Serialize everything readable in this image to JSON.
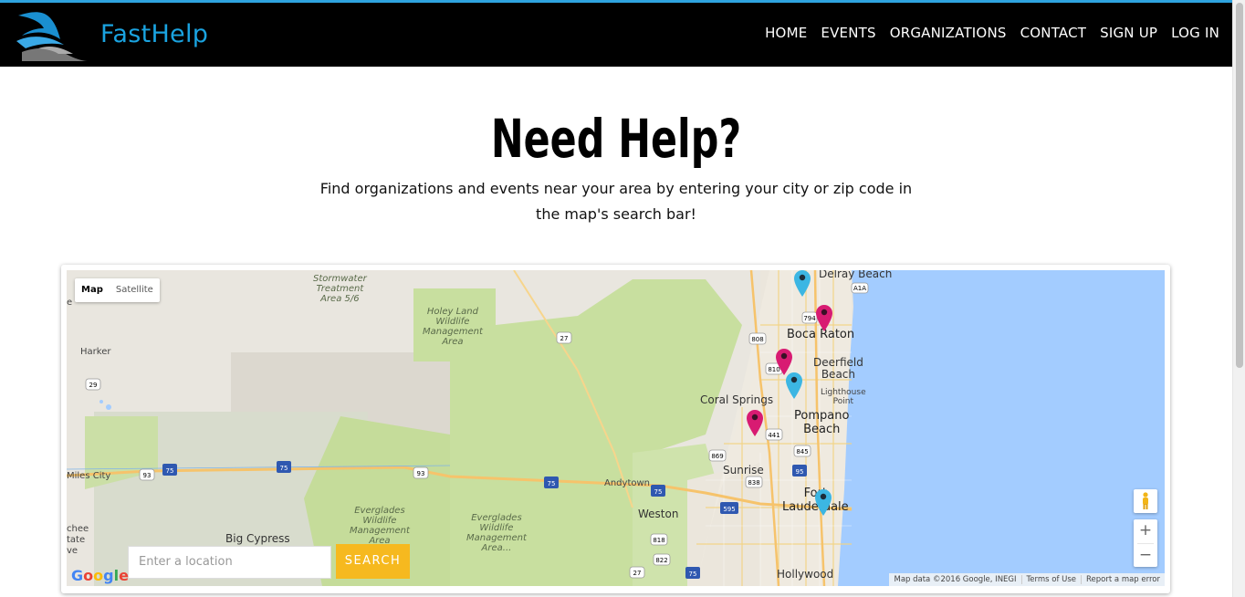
{
  "brand": {
    "name": "FastHelp"
  },
  "nav": {
    "items": [
      "HOME",
      "EVENTS",
      "ORGANIZATIONS",
      "CONTACT",
      "SIGN UP",
      "LOG IN"
    ]
  },
  "hero": {
    "title": "Need Help?",
    "subtitle": "Find organizations and events near your area by entering your city or zip code in the map's search bar!"
  },
  "map": {
    "type_buttons": {
      "map": "Map",
      "satellite": "Satellite"
    },
    "search": {
      "placeholder": "Enter a location",
      "button": "SEARCH"
    },
    "labels": {
      "delray": "Delray Beach",
      "boca": "Boca Raton",
      "deerfield": "Deerfield\nBeach",
      "lighthouse": "Lighthouse\nPoint",
      "coral": "Coral Springs",
      "pompano": "Pompano\nBeach",
      "sunrise": "Sunrise",
      "ftl": "Fort\nLauderdale",
      "weston": "Weston",
      "hollywood": "Hollywood",
      "andytown": "Andytown",
      "harker": "Harker",
      "miles": "Miles City",
      "bigcypress": "Big Cypress",
      "stormwater": "Stormwater\nTreatment\nArea 5/6",
      "holey": "Holey Land\nWildlife\nManagement\nArea",
      "everglades1": "Everglades\nWildlife\nManagement\nArea",
      "everglades2": "Everglades\nWildlife\nManagement\nArea...",
      "leftedge": "chee\ntate\nve",
      "e": "e"
    },
    "google": "Google",
    "attribution": [
      "Map data ©2016 Google, INEGI",
      "Terms of Use",
      "Report a map error"
    ]
  },
  "colors": {
    "accent": "#1aa3e0",
    "search_button": "#f6b91f",
    "pin_org": "#d81b72",
    "pin_event": "#3cb6e3",
    "water": "#a3ccff",
    "park": "#c8df9f"
  }
}
